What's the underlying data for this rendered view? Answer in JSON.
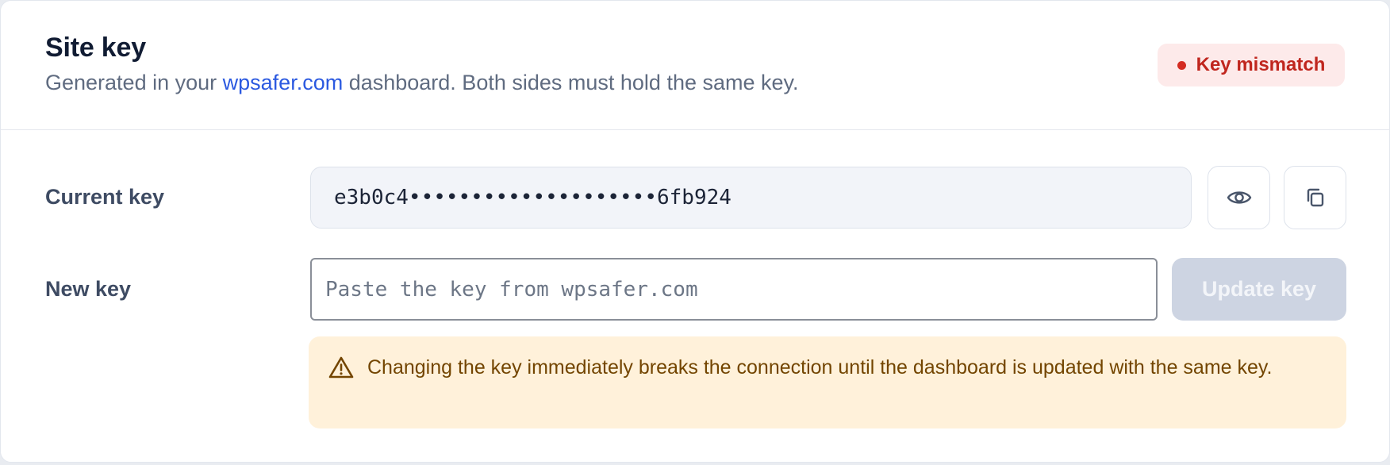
{
  "header": {
    "title": "Site key",
    "subtitle_before": "Generated in your ",
    "subtitle_link": "wpsafer.com",
    "subtitle_after": " dashboard. Both sides must hold the same key.",
    "status_badge": "Key mismatch"
  },
  "current_key": {
    "label": "Current key",
    "value": "e3b0c4••••••••••••••••••••6fb924",
    "reveal_icon": "eye-icon",
    "copy_icon": "copy-icon"
  },
  "new_key": {
    "label": "New key",
    "value": "",
    "placeholder": "Paste the key from wpsafer.com",
    "button_label": "Update key"
  },
  "warning": {
    "icon": "warning-triangle-icon",
    "text": "Changing the key immediately breaks the connection until the dashboard is updated with the same key."
  },
  "colors": {
    "accent_link": "#2b59e0",
    "badge_bg": "#fdeaea",
    "badge_text": "#c0261e",
    "warning_bg": "#fff1da",
    "warning_text": "#734500",
    "disabled_button": "#cdd4e2"
  }
}
